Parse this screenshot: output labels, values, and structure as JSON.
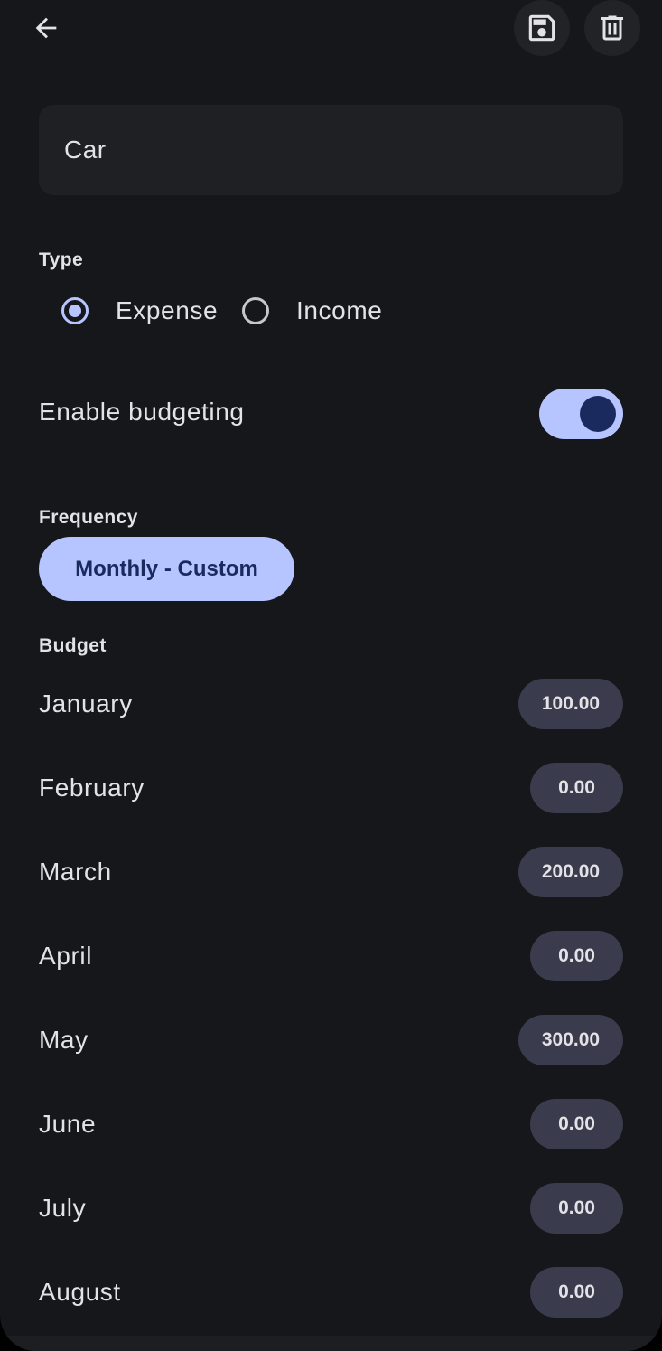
{
  "header": {
    "back_icon": "arrow-back-icon",
    "save_icon": "save-icon",
    "delete_icon": "delete-icon"
  },
  "category": {
    "name": "Car"
  },
  "type_section": {
    "label": "Type",
    "options": [
      {
        "label": "Expense",
        "checked": true
      },
      {
        "label": "Income",
        "checked": false
      }
    ]
  },
  "budgeting": {
    "label": "Enable budgeting",
    "enabled": true
  },
  "frequency": {
    "label": "Frequency",
    "value": "Monthly - Custom"
  },
  "budget": {
    "label": "Budget",
    "months": [
      {
        "name": "January",
        "amount": "100.00"
      },
      {
        "name": "February",
        "amount": "0.00"
      },
      {
        "name": "March",
        "amount": "200.00"
      },
      {
        "name": "April",
        "amount": "0.00"
      },
      {
        "name": "May",
        "amount": "300.00"
      },
      {
        "name": "June",
        "amount": "0.00"
      },
      {
        "name": "July",
        "amount": "0.00"
      },
      {
        "name": "August",
        "amount": "0.00"
      }
    ]
  },
  "colors": {
    "background": "#16171a",
    "accent": "#b6c4ff",
    "on_accent": "#1b2a5e",
    "chip": "#3a3b4c"
  }
}
